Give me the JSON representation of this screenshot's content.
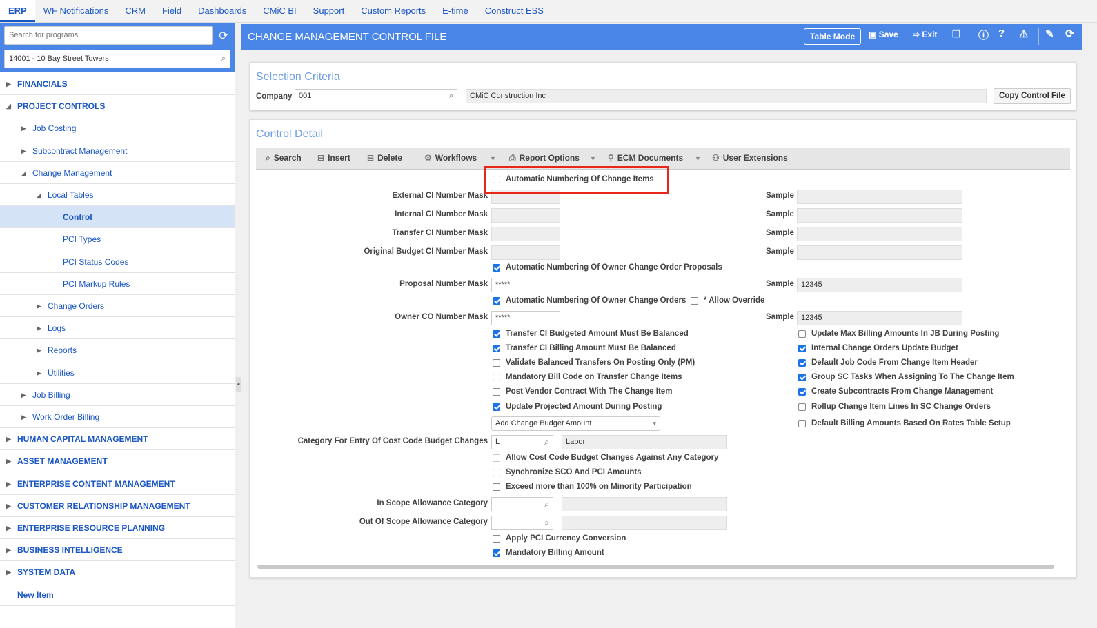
{
  "topnav": [
    "ERP",
    "WF Notifications",
    "CRM",
    "Field",
    "Dashboards",
    "CMiC BI",
    "Support",
    "Custom Reports",
    "E-time",
    "Construct ESS"
  ],
  "sidebar": {
    "search_placeholder": "Search for programs...",
    "project_value": "14001 - 10 Bay Street Towers",
    "items": [
      {
        "label": "FINANCIALS",
        "level": 0,
        "state": "collapsed"
      },
      {
        "label": "PROJECT CONTROLS",
        "level": 0,
        "state": "expanded"
      },
      {
        "label": "Job Costing",
        "level": 1,
        "state": "collapsed"
      },
      {
        "label": "Subcontract Management",
        "level": 1,
        "state": "collapsed"
      },
      {
        "label": "Change Management",
        "level": 1,
        "state": "expanded"
      },
      {
        "label": "Local Tables",
        "level": 2,
        "state": "expanded"
      },
      {
        "label": "Control",
        "level": 3,
        "state": "leaf",
        "selected": true
      },
      {
        "label": "PCI Types",
        "level": 3,
        "state": "leaf"
      },
      {
        "label": "PCI Status Codes",
        "level": 3,
        "state": "leaf"
      },
      {
        "label": "PCI Markup Rules",
        "level": 3,
        "state": "leaf"
      },
      {
        "label": "Change Orders",
        "level": 2,
        "state": "collapsed"
      },
      {
        "label": "Logs",
        "level": 2,
        "state": "collapsed"
      },
      {
        "label": "Reports",
        "level": 2,
        "state": "collapsed"
      },
      {
        "label": "Utilities",
        "level": 2,
        "state": "collapsed"
      },
      {
        "label": "Job Billing",
        "level": 1,
        "state": "collapsed"
      },
      {
        "label": "Work Order Billing",
        "level": 1,
        "state": "collapsed"
      },
      {
        "label": "HUMAN CAPITAL MANAGEMENT",
        "level": 0,
        "state": "collapsed"
      },
      {
        "label": "ASSET MANAGEMENT",
        "level": 0,
        "state": "collapsed"
      },
      {
        "label": "ENTERPRISE CONTENT MANAGEMENT",
        "level": 0,
        "state": "collapsed"
      },
      {
        "label": "CUSTOMER RELATIONSHIP MANAGEMENT",
        "level": 0,
        "state": "collapsed"
      },
      {
        "label": "ENTERPRISE RESOURCE PLANNING",
        "level": 0,
        "state": "collapsed"
      },
      {
        "label": "BUSINESS INTELLIGENCE",
        "level": 0,
        "state": "collapsed"
      },
      {
        "label": "SYSTEM DATA",
        "level": 0,
        "state": "collapsed"
      },
      {
        "label": "New Item",
        "level": 0,
        "state": "leaf"
      }
    ]
  },
  "header": {
    "title": "CHANGE MANAGEMENT CONTROL FILE",
    "table_mode": "Table Mode",
    "save": "Save",
    "exit": "Exit"
  },
  "selection": {
    "title": "Selection Criteria",
    "company_label": "Company",
    "company_value": "001",
    "company_name": "CMiC Construction Inc",
    "copy_button": "Copy Control File"
  },
  "detail": {
    "title": "Control Detail",
    "toolbar": [
      "Search",
      "Insert",
      "Delete",
      "Workflows",
      "Report Options",
      "ECM Documents",
      "User Extensions"
    ],
    "highlight_checkbox": {
      "label": "Automatic Numbering Of Change Items",
      "checked": false
    },
    "masks": [
      {
        "label": "External CI Number Mask",
        "value": "",
        "sample": ""
      },
      {
        "label": "Internal CI Number Mask",
        "value": "",
        "sample": ""
      },
      {
        "label": "Transfer CI Number Mask",
        "value": "",
        "sample": ""
      },
      {
        "label": "Original Budget CI Number Mask",
        "value": "",
        "sample": ""
      }
    ],
    "sample_label": "Sample",
    "auto_proposals": {
      "label": "Automatic Numbering Of Owner Change Order Proposals",
      "checked": true
    },
    "proposal_mask": {
      "label": "Proposal Number Mask",
      "value": "*****",
      "sample": "12345"
    },
    "auto_owner_co": {
      "label": "Automatic Numbering Of Owner Change Orders",
      "checked": true
    },
    "allow_override": {
      "label": "* Allow Override",
      "checked": false
    },
    "owner_co_mask": {
      "label": "Owner CO Number Mask",
      "value": "*****",
      "sample": "12345"
    },
    "left_checks": [
      {
        "label": "Transfer CI Budgeted Amount Must Be Balanced",
        "checked": true
      },
      {
        "label": "Transfer CI Billing Amount Must Be Balanced",
        "checked": true
      },
      {
        "label": "Validate Balanced Transfers On Posting Only (PM)",
        "checked": false
      },
      {
        "label": "Mandatory Bill Code on Transfer Change Items",
        "checked": false
      },
      {
        "label": "Post Vendor Contract With The Change Item",
        "checked": false
      },
      {
        "label": "Update Projected Amount During Posting",
        "checked": true
      }
    ],
    "right_checks": [
      {
        "label": "Update Max Billing Amounts In JB During Posting",
        "checked": false
      },
      {
        "label": "Internal Change Orders Update Budget",
        "checked": true
      },
      {
        "label": "Default Job Code From Change Item Header",
        "checked": true
      },
      {
        "label": "Group SC Tasks When Assigning To The Change Item",
        "checked": true
      },
      {
        "label": "Create Subcontracts From Change Management",
        "checked": true
      },
      {
        "label": "Rollup Change Item Lines In SC Change Orders",
        "checked": false
      },
      {
        "label": "Default Billing Amounts Based On Rates Table Setup",
        "checked": false
      }
    ],
    "budget_select": "Add Change Budget Amount",
    "category": {
      "label": "Category For Entry Of Cost Code Budget Changes",
      "code": "L",
      "name": "Labor"
    },
    "mid_checks": [
      {
        "label": "Allow Cost Code Budget Changes Against Any Category",
        "checked": false,
        "disabled": true
      },
      {
        "label": "Synchronize SCO And PCI Amounts",
        "checked": false
      },
      {
        "label": "Exceed more than 100% on Minority Participation",
        "checked": false
      }
    ],
    "in_scope": {
      "label": "In Scope Allowance Category",
      "value": "",
      "name": ""
    },
    "out_scope": {
      "label": "Out Of Scope Allowance Category",
      "value": "",
      "name": ""
    },
    "bottom_checks": [
      {
        "label": "Apply PCI Currency Conversion",
        "checked": false
      },
      {
        "label": "Mandatory Billing Amount",
        "checked": true
      }
    ]
  },
  "colors": {
    "brand_blue": "#4a86e8",
    "link": "#1a56c4",
    "highlight": "#e8271a"
  }
}
